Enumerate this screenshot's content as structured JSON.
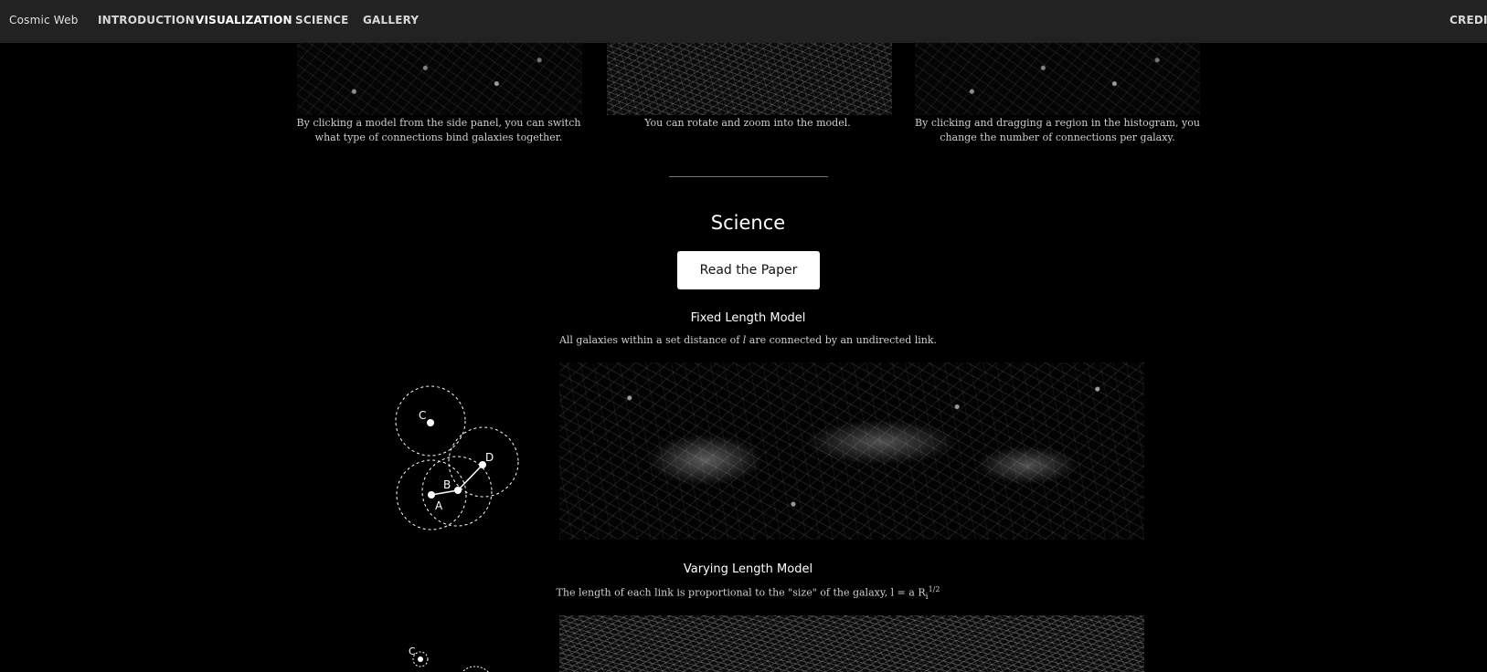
{
  "nav": {
    "brand": "Cosmic Web",
    "items": [
      "INTRODUCTION",
      "VISUALIZATION",
      "SCIENCE",
      "GALLERY"
    ],
    "active": "VISUALIZATION",
    "credits": "CREDITS"
  },
  "visualization": {
    "captions": [
      "By clicking a model from the side panel, you can switch what type of connections bind galaxies together.",
      "You can rotate and zoom into the model.",
      "By clicking and dragging a region in the histogram, you change the number of connections per galaxy."
    ]
  },
  "science": {
    "title": "Science",
    "read_button": "Read the Paper",
    "models": [
      {
        "title": "Fixed Length Model",
        "description_pre": "All galaxies within a set distance of ",
        "description_var": "l",
        "description_post": " are connected by an undirected link.",
        "diagram_labels": [
          "C",
          "D",
          "B",
          "A"
        ]
      },
      {
        "title": "Varying Length Model",
        "description_pre": "The length of each link is proportional to the \"size\" of the galaxy, l = a R",
        "description_sub": "i",
        "description_sup": "1/2",
        "diagram_labels": [
          "C"
        ]
      }
    ]
  },
  "colors": {
    "nav_bg": "#222222",
    "page_bg": "#000000",
    "button_bg": "#ffffff",
    "text": "#ffffff"
  }
}
